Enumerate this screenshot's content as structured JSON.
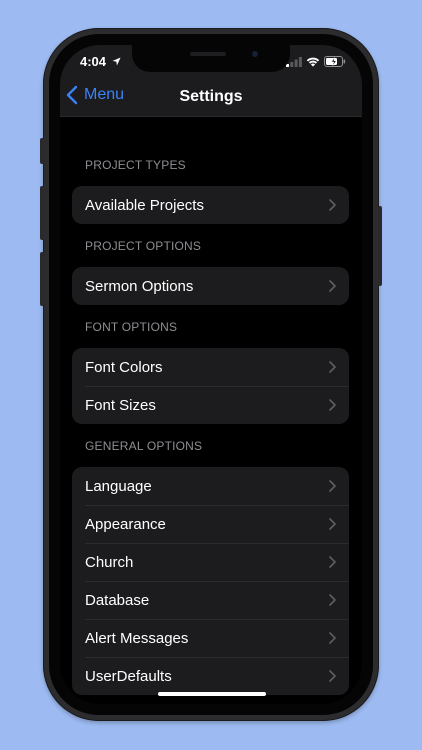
{
  "status_bar": {
    "time": "4:04"
  },
  "nav": {
    "back_label": "Menu",
    "title": "Settings"
  },
  "sections": [
    {
      "header": "PROJECT TYPES",
      "items": [
        {
          "label": "Available Projects"
        }
      ]
    },
    {
      "header": "PROJECT OPTIONS",
      "items": [
        {
          "label": "Sermon Options"
        }
      ]
    },
    {
      "header": "FONT OPTIONS",
      "items": [
        {
          "label": "Font Colors"
        },
        {
          "label": "Font Sizes"
        }
      ]
    },
    {
      "header": "GENERAL OPTIONS",
      "items": [
        {
          "label": "Language"
        },
        {
          "label": "Appearance"
        },
        {
          "label": "Church"
        },
        {
          "label": "Database"
        },
        {
          "label": "Alert Messages"
        },
        {
          "label": "UserDefaults"
        }
      ]
    }
  ],
  "colors": {
    "background": "#9dbbf2",
    "accent": "#3b82f6",
    "cell": "#1c1c1e",
    "section_header": "#8e8e93"
  },
  "icons": {
    "location": "location-arrow-icon",
    "signal": "cellular-signal-icon",
    "wifi": "wifi-icon",
    "battery": "battery-charging-icon",
    "back": "chevron-left-icon",
    "row": "chevron-right-icon"
  }
}
